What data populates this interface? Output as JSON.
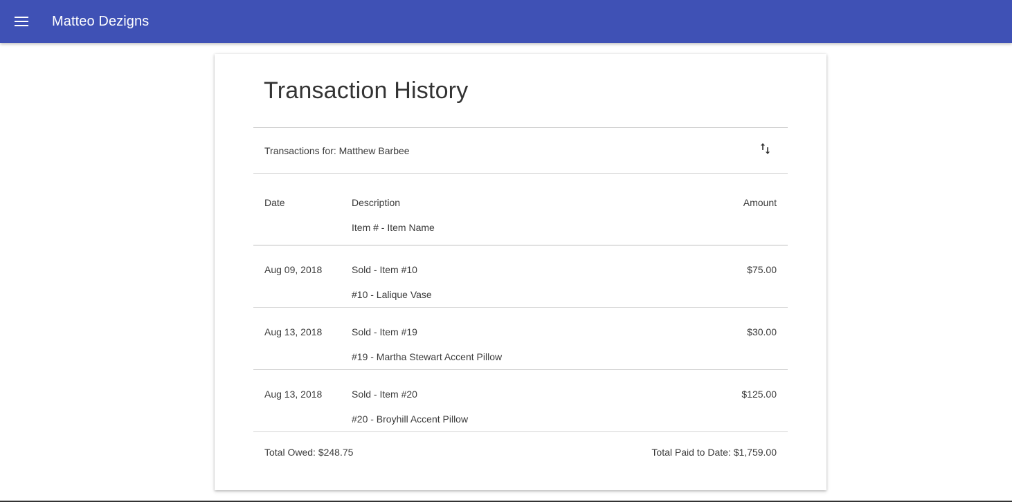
{
  "appbar": {
    "title": "Matteo Dezigns",
    "menu_icon": "menu-icon",
    "background": "#3f51b5"
  },
  "page": {
    "title": "Transaction History"
  },
  "toolbar": {
    "label": "Transactions for: Matthew Barbee",
    "sort_icon": "sort-arrows-icon"
  },
  "table": {
    "headers": {
      "date": "Date",
      "description": "Description",
      "item": "Item # - Item Name",
      "amount": "Amount"
    },
    "rows": [
      {
        "date": "Aug 09, 2018",
        "description": "Sold - Item #10",
        "item": "#10 - Lalique Vase",
        "amount": "$75.00"
      },
      {
        "date": "Aug 13, 2018",
        "description": "Sold - Item #19",
        "item": "#19 - Martha Stewart Accent Pillow",
        "amount": "$30.00"
      },
      {
        "date": "Aug 13, 2018",
        "description": "Sold - Item #20",
        "item": "#20 - Broyhill Accent Pillow",
        "amount": "$125.00"
      }
    ]
  },
  "footer": {
    "total_owed": "Total Owed: $248.75",
    "total_paid": "Total Paid to Date: $1,759.00"
  }
}
